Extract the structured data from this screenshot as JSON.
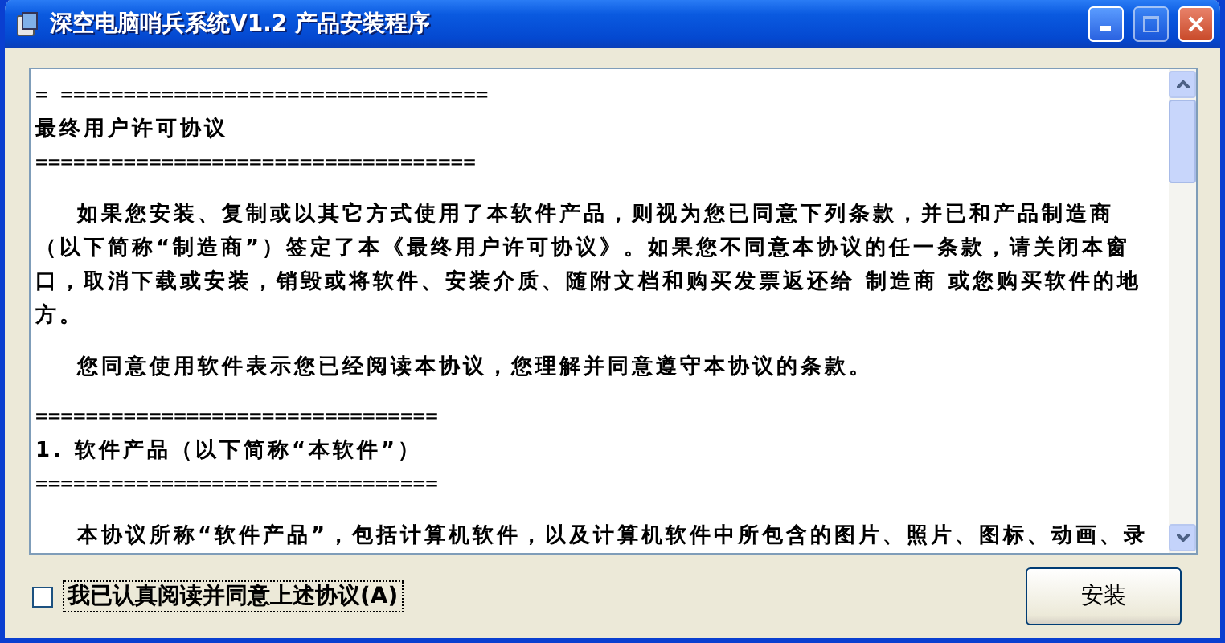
{
  "window": {
    "title": "深空电脑哨兵系统V1.2 产品安装程序"
  },
  "license_text": [
    {
      "kind": "rule",
      "text": "= =================================="
    },
    {
      "kind": "heading",
      "text": "最终用户许可协议"
    },
    {
      "kind": "rule",
      "text": "==================================="
    },
    {
      "kind": "gap"
    },
    {
      "kind": "paragraph",
      "text": "如果您安装、复制或以其它方式使用了本软件产品，则视为您已同意下列条款，并已和产品制造商（以下简称“制造商”）签定了本《最终用户许可协议》。如果您不同意本协议的任一条款，请关闭本窗口，取消下载或安装，销毁或将软件、安装介质、随附文档和购买发票返还给 制造商 或您购买软件的地方。"
    },
    {
      "kind": "gap"
    },
    {
      "kind": "paragraph",
      "text": "您同意使用软件表示您已经阅读本协议，您理解并同意遵守本协议的条款。"
    },
    {
      "kind": "gap"
    },
    {
      "kind": "rule",
      "text": "================================"
    },
    {
      "kind": "heading",
      "text": "1. 软件产品（以下简称“本软件”）"
    },
    {
      "kind": "rule",
      "text": "================================"
    },
    {
      "kind": "gap"
    },
    {
      "kind": "paragraph",
      "text": "本协议所称“软件产品”，包括计算机软件，以及计算机软件中所包含的图片、照片、图标、动画、录"
    }
  ],
  "agree": {
    "label": "我已认真阅读并同意上述协议(A)",
    "checked": false
  },
  "install_button": {
    "label": "安装",
    "disabled": false
  }
}
